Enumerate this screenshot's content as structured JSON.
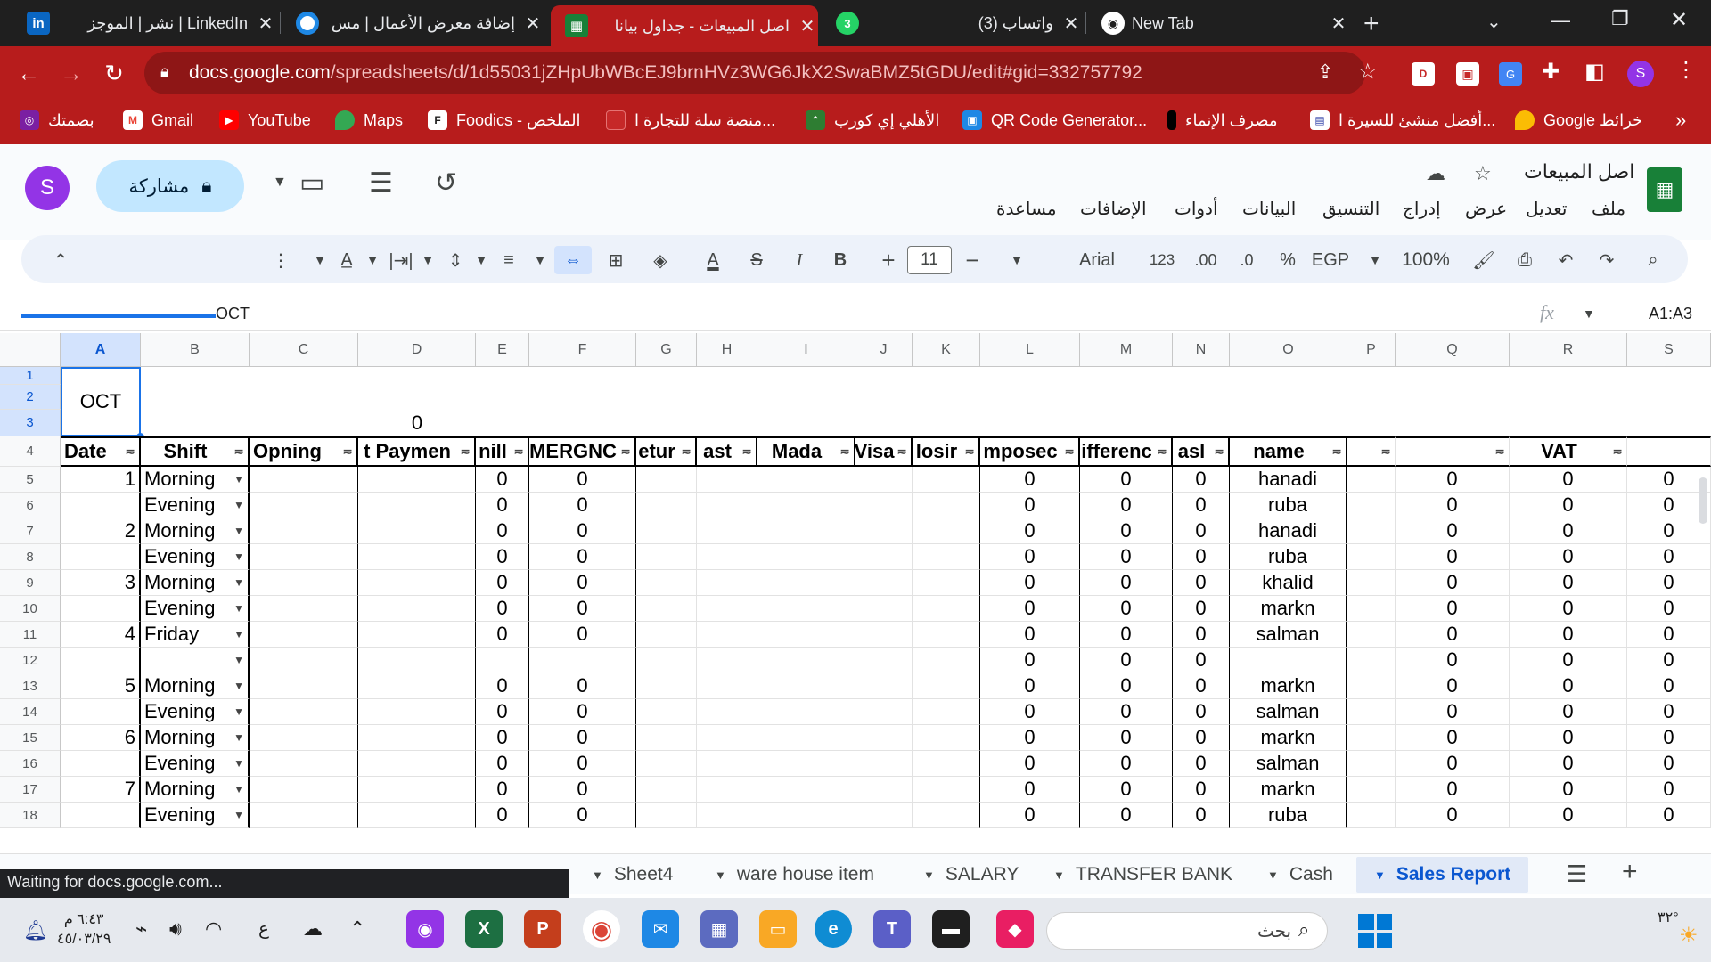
{
  "browser": {
    "tabs": [
      {
        "title": "نشر | الموجز | LinkedIn",
        "icon": "linkedin-icon"
      },
      {
        "title": "إضافة معرض الأعمال | مس",
        "icon": "mostaql-icon"
      },
      {
        "title": "اصل المبيعات - جداول بيانا",
        "icon": "sheets-icon"
      },
      {
        "title": "(3) واتساب",
        "icon": "whatsapp-icon"
      },
      {
        "title": "New Tab",
        "icon": "chrome-icon"
      }
    ],
    "whatsapp_badge": "3",
    "url_host": "docs.google.com",
    "url_path": "/spreadsheets/d/1d55031jZHpUbWBcEJ9brnHVz3WG6JkX2SwaBMZ5tGDU/edit#gid=332757792",
    "profile_initial": "S",
    "bookmarks": [
      "بصمتك",
      "Gmail",
      "YouTube",
      "Maps",
      "Foodics - الملخص",
      "منصة سلة للتجارة ا...",
      "الأهلي إي كورب",
      "QR Code Generator...",
      "مصرف الإنماء",
      "أفضل منشئ للسيرة ا...",
      "Google خرائط"
    ],
    "bookmarks_more": "»"
  },
  "sheets": {
    "doc_title": "اصل المبيعات",
    "menus": [
      "ملف",
      "تعديل",
      "عرض",
      "إدراج",
      "التنسيق",
      "البيانات",
      "أدوات",
      "الإضافات",
      "مساعدة"
    ],
    "share_label": "مشاركة",
    "avatar_initial": "S",
    "toolbar": {
      "zoom": "100%",
      "currency": "EGP",
      "percent": "%",
      "dec_less": ".0",
      "dec_more": ".00",
      "format_123": "123",
      "font": "Arial",
      "font_size": "11",
      "minus": "−",
      "plus": "+",
      "bold": "B",
      "italic": "I",
      "strike": "S",
      "text_color": "A"
    },
    "name_box": "A1:A3",
    "formula_value": "OCT",
    "columns": [
      "A",
      "B",
      "C",
      "D",
      "E",
      "F",
      "G",
      "H",
      "I",
      "J",
      "K",
      "L",
      "M",
      "N",
      "O",
      "P",
      "Q",
      "R",
      "S"
    ],
    "rows": [
      "1",
      "2",
      "3",
      "4",
      "5",
      "6",
      "7",
      "8",
      "9",
      "10",
      "11",
      "12",
      "13",
      "14",
      "15",
      "16",
      "17",
      "18"
    ],
    "merged_cell": "OCT",
    "d3_value": "0",
    "headers": {
      "A": "Date",
      "B": "Shift",
      "C": "Opning",
      "D": "t Paymen",
      "E": "nill",
      "F": "MERGNC",
      "G": "etur",
      "H": "ast",
      "I": "Mada",
      "J": "Visa",
      "K": "losir",
      "L": "mposec",
      "M": "ifferenc",
      "N": "asl",
      "O": "name",
      "P": "",
      "Q": "",
      "R": "VAT",
      "S": ""
    },
    "data_rows": [
      {
        "row": "5",
        "date": "1",
        "shift": "Morning",
        "e": "0",
        "f": "0",
        "l": "0",
        "m": "0",
        "n": "0",
        "name": "hanadi",
        "q": "0",
        "r": "0",
        "s": "0"
      },
      {
        "row": "6",
        "date": "",
        "shift": "Evening",
        "e": "0",
        "f": "0",
        "l": "0",
        "m": "0",
        "n": "0",
        "name": "ruba",
        "q": "0",
        "r": "0",
        "s": "0"
      },
      {
        "row": "7",
        "date": "2",
        "shift": "Morning",
        "e": "0",
        "f": "0",
        "l": "0",
        "m": "0",
        "n": "0",
        "name": "hanadi",
        "q": "0",
        "r": "0",
        "s": "0"
      },
      {
        "row": "8",
        "date": "",
        "shift": "Evening",
        "e": "0",
        "f": "0",
        "l": "0",
        "m": "0",
        "n": "0",
        "name": "ruba",
        "q": "0",
        "r": "0",
        "s": "0"
      },
      {
        "row": "9",
        "date": "3",
        "shift": "Morning",
        "e": "0",
        "f": "0",
        "l": "0",
        "m": "0",
        "n": "0",
        "name": "khalid",
        "q": "0",
        "r": "0",
        "s": "0"
      },
      {
        "row": "10",
        "date": "",
        "shift": "Evening",
        "e": "0",
        "f": "0",
        "l": "0",
        "m": "0",
        "n": "0",
        "name": "markn",
        "q": "0",
        "r": "0",
        "s": "0"
      },
      {
        "row": "11",
        "date": "4",
        "shift": "Friday",
        "e": "0",
        "f": "0",
        "l": "0",
        "m": "0",
        "n": "0",
        "name": "salman",
        "q": "0",
        "r": "0",
        "s": "0"
      },
      {
        "row": "12",
        "date": "",
        "shift": "",
        "e": "",
        "f": "",
        "l": "0",
        "m": "0",
        "n": "0",
        "name": "",
        "q": "0",
        "r": "0",
        "s": "0"
      },
      {
        "row": "13",
        "date": "5",
        "shift": "Morning",
        "e": "0",
        "f": "0",
        "l": "0",
        "m": "0",
        "n": "0",
        "name": "markn",
        "q": "0",
        "r": "0",
        "s": "0"
      },
      {
        "row": "14",
        "date": "",
        "shift": "Evening",
        "e": "0",
        "f": "0",
        "l": "0",
        "m": "0",
        "n": "0",
        "name": "salman",
        "q": "0",
        "r": "0",
        "s": "0"
      },
      {
        "row": "15",
        "date": "6",
        "shift": "Morning",
        "e": "0",
        "f": "0",
        "l": "0",
        "m": "0",
        "n": "0",
        "name": "markn",
        "q": "0",
        "r": "0",
        "s": "0"
      },
      {
        "row": "16",
        "date": "",
        "shift": "Evening",
        "e": "0",
        "f": "0",
        "l": "0",
        "m": "0",
        "n": "0",
        "name": "salman",
        "q": "0",
        "r": "0",
        "s": "0"
      },
      {
        "row": "17",
        "date": "7",
        "shift": "Morning",
        "e": "0",
        "f": "0",
        "l": "0",
        "m": "0",
        "n": "0",
        "name": "markn",
        "q": "0",
        "r": "0",
        "s": "0"
      },
      {
        "row": "18",
        "date": "",
        "shift": "Evening",
        "e": "0",
        "f": "0",
        "l": "0",
        "m": "0",
        "n": "0",
        "name": "ruba",
        "q": "0",
        "r": "0",
        "s": "0"
      }
    ],
    "sheet_tabs": [
      "Sheet4",
      "ware house item",
      "SALARY",
      "TRANSFER BANK",
      "Cash",
      "Sales Report"
    ],
    "active_sheet": "Sales Report"
  },
  "status_text": "Waiting for docs.google.com...",
  "taskbar": {
    "search_placeholder": "بحث",
    "time": "٦:٤٣ م",
    "date": "٤٥/٠٣/٢٩",
    "lang": "ع",
    "weather": "٣٢°"
  },
  "colors": {
    "chrome_red": "#b71c1c",
    "sheets_green": "#188038",
    "selection_blue": "#1a73e8"
  }
}
